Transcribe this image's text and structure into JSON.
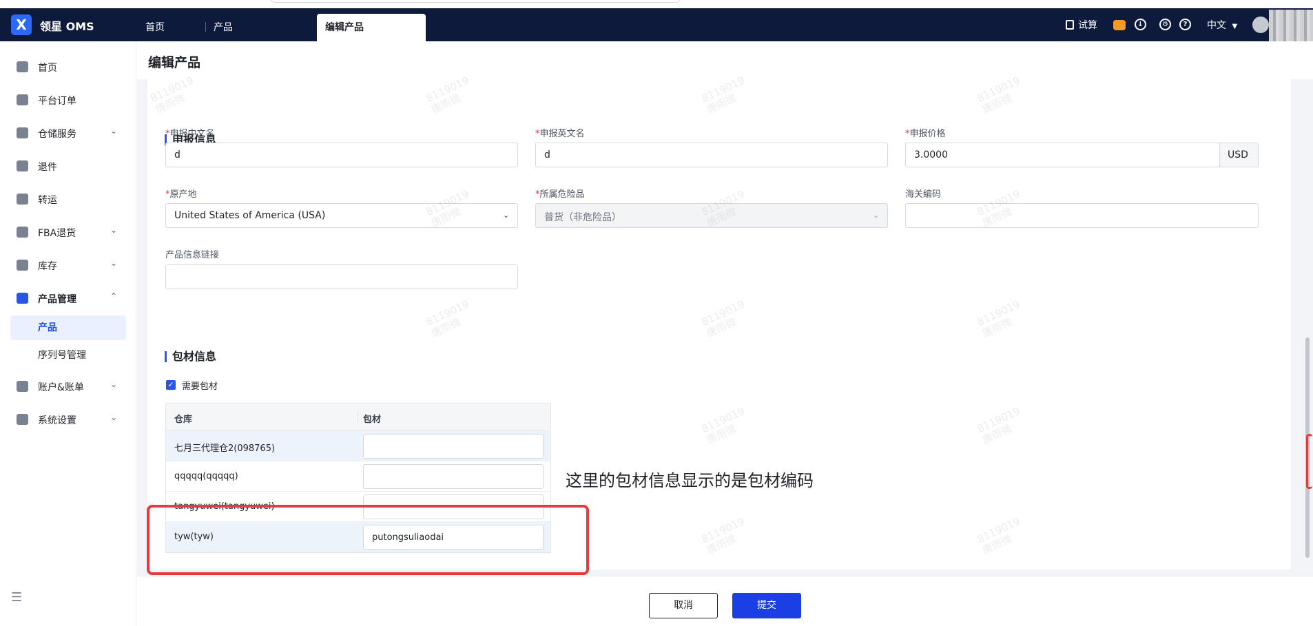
{
  "topbar": {
    "brand": "领星 OMS",
    "logo_glyph": "X",
    "tabs": [
      {
        "label": "首页"
      },
      {
        "label": "产品"
      },
      {
        "label": "编辑产品"
      }
    ],
    "calc_label": "试算",
    "language": "中文",
    "icons": [
      "calculator-icon",
      "robot-icon",
      "download-icon",
      "settings-icon",
      "help-icon"
    ]
  },
  "sidebar": {
    "items": [
      {
        "label": "首页",
        "icon": "home-icon"
      },
      {
        "label": "平台订单",
        "icon": "clipboard-icon"
      },
      {
        "label": "仓储服务",
        "icon": "warehouse-icon",
        "has_children": true
      },
      {
        "label": "退件",
        "icon": "return-icon"
      },
      {
        "label": "转运",
        "icon": "transfer-icon"
      },
      {
        "label": "FBA退货",
        "icon": "fba-icon",
        "has_children": true
      },
      {
        "label": "库存",
        "icon": "inventory-icon",
        "has_children": true
      },
      {
        "label": "产品管理",
        "icon": "product-icon",
        "expanded": true
      },
      {
        "label": "账户&账单",
        "icon": "account-icon",
        "has_children": true
      },
      {
        "label": "系统设置",
        "icon": "settings-icon",
        "has_children": true
      }
    ],
    "sub_items": [
      {
        "label": "产品",
        "active": true
      },
      {
        "label": "序列号管理"
      }
    ]
  },
  "page": {
    "title": "编辑产品"
  },
  "declare": {
    "section_title": "申报信息",
    "fields": {
      "cn_name": {
        "label": "申报中文名",
        "required": true,
        "value": "d"
      },
      "en_name": {
        "label": "申报英文名",
        "required": true,
        "value": "d"
      },
      "price": {
        "label": "申报价格",
        "required": true,
        "value": "3.0000",
        "currency": "USD"
      },
      "origin": {
        "label": "原产地",
        "required": true,
        "value": "United States of America (USA)"
      },
      "danger": {
        "label": "所属危险品",
        "required": true,
        "value": "普货（非危险品）"
      },
      "hs_code": {
        "label": "海关编码",
        "value": ""
      },
      "info_link": {
        "label": "产品信息链接",
        "value": ""
      }
    }
  },
  "packaging": {
    "section_title": "包材信息",
    "need_packaging_label": "需要包材",
    "need_packaging": true,
    "columns": [
      "仓库",
      "包材"
    ],
    "rows": [
      {
        "warehouse": "七月三代理仓2(098765)",
        "material": ""
      },
      {
        "warehouse": "qqqqq(qqqqq)",
        "material": ""
      },
      {
        "warehouse": "tangyuwei(tangyuwei)",
        "material": ""
      },
      {
        "warehouse": "tyw(tyw)",
        "material": "putongsuliaodai"
      }
    ]
  },
  "annotation_text": "这里的包材信息显示的是包材编码",
  "footer": {
    "cancel": "取消",
    "submit": "提交"
  },
  "watermark": {
    "line1": "8119019",
    "line2": "唐雨微"
  },
  "colors": {
    "topbar": "#0d1a3c",
    "accent": "#2b55e6",
    "submit": "#1a3fe4",
    "annotation_box": "#e8393d",
    "required": "#e43d3d"
  }
}
